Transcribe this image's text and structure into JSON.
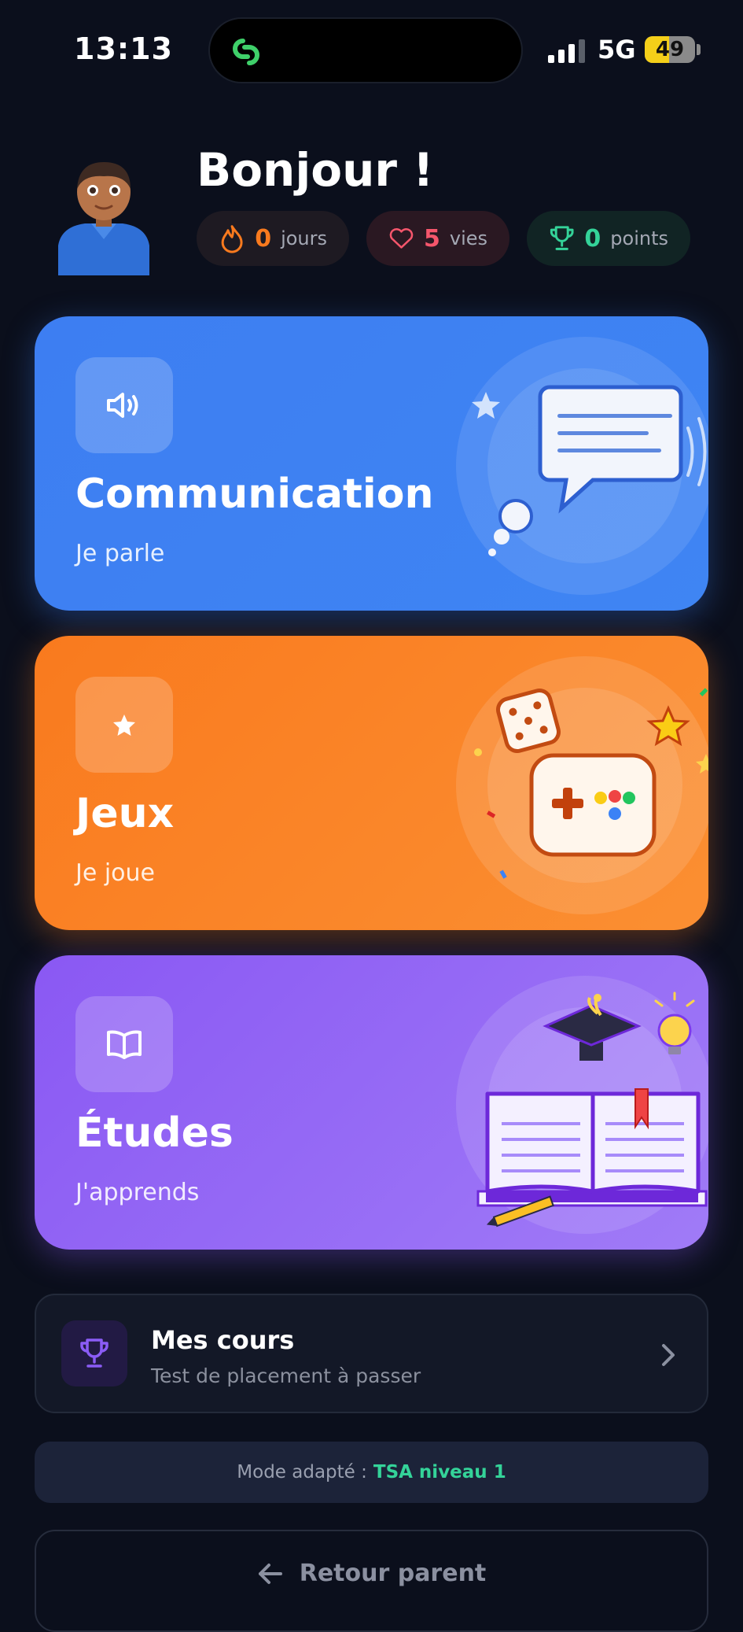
{
  "status_bar": {
    "time": "13:13",
    "network": "5G",
    "battery": "49"
  },
  "header": {
    "greeting": "Bonjour !",
    "stats": [
      {
        "value": "0",
        "label": "jours",
        "icon": "flame-icon",
        "color": "#f97a1e"
      },
      {
        "value": "5",
        "label": "vies",
        "icon": "heart-icon",
        "color": "#f5566c"
      },
      {
        "value": "0",
        "label": "points",
        "icon": "trophy-icon",
        "color": "#34d399"
      }
    ]
  },
  "cards": [
    {
      "title": "Communication",
      "subtitle": "Je parle",
      "icon": "speaker-icon",
      "color": "#3d7ef2"
    },
    {
      "title": "Jeux",
      "subtitle": "Je joue",
      "icon": "star-icon",
      "color": "#f97a1e"
    },
    {
      "title": "Études",
      "subtitle": "J'apprends",
      "icon": "book-icon",
      "color": "#8a58f3"
    }
  ],
  "courses": {
    "title": "Mes cours",
    "subtitle": "Test de placement à passer",
    "icon": "trophy-icon"
  },
  "mode": {
    "label": "Mode adapté :",
    "value": "TSA niveau 1"
  },
  "back_button": {
    "label": "Retour parent",
    "icon": "arrow-left-icon"
  }
}
